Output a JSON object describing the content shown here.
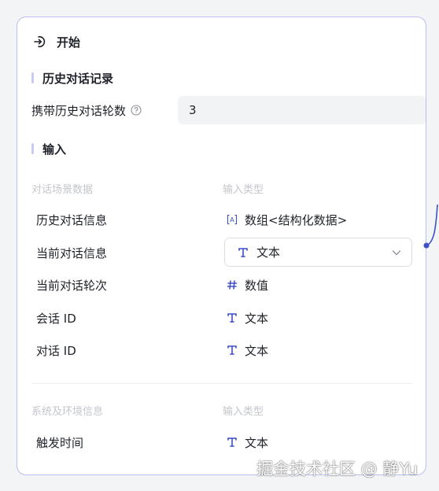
{
  "colors": {
    "accent": "#3d4ec8",
    "border": "#b9bdf0",
    "section_bar": "#c7caf5",
    "muted": "#c3c6cc"
  },
  "header": {
    "title": "开始",
    "icon": "login-arrow-icon"
  },
  "history": {
    "section_title": "历史对话记录",
    "carry_label": "携带历史对话轮数",
    "help_icon": "question-circle-icon",
    "carry_value": "3"
  },
  "input": {
    "section_title": "输入",
    "group1": {
      "col_name": "对话场景数据",
      "col_type": "输入类型",
      "rows": [
        {
          "name": "历史对话信息",
          "type": "数组<结构化数据>",
          "icon": "array-bracket-icon"
        },
        {
          "name": "当前对话信息",
          "type": "文本",
          "icon": "text-t-icon"
        },
        {
          "name": "当前对话轮次",
          "type": "数值",
          "icon": "hash-icon"
        },
        {
          "name": "会话 ID",
          "type": "文本",
          "icon": "text-t-icon"
        },
        {
          "name": "对话 ID",
          "type": "文本",
          "icon": "text-t-icon"
        }
      ]
    },
    "group2": {
      "col_name": "系统及环境信息",
      "col_type": "输入类型",
      "rows": [
        {
          "name": "触发时间",
          "type": "文本",
          "icon": "text-t-icon"
        }
      ]
    }
  },
  "watermark": "掘金技术社区 @ 静Yu"
}
